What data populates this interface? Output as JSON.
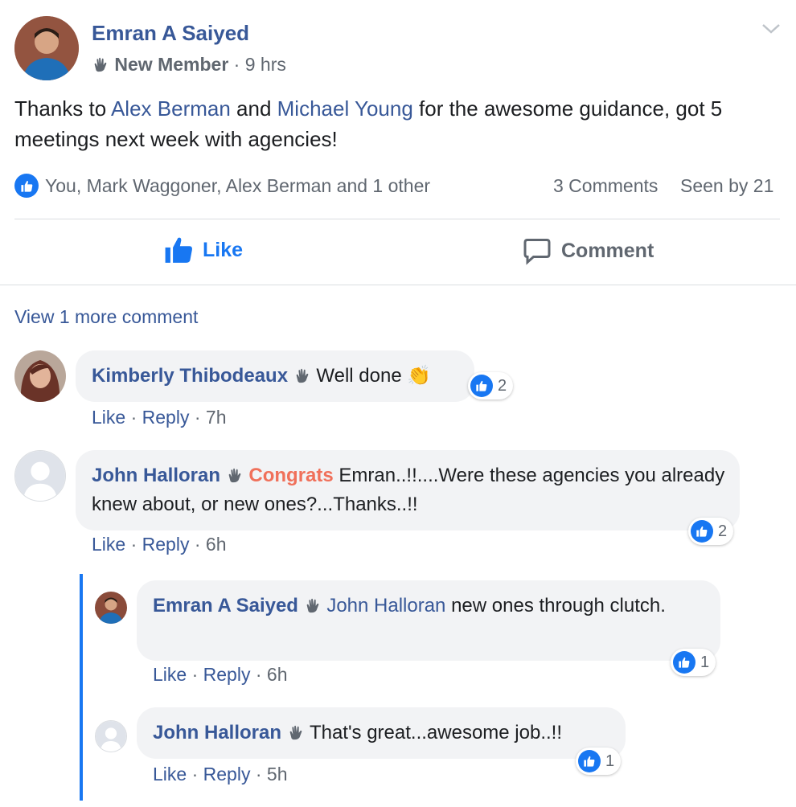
{
  "post": {
    "author": "Emran A Saiyed",
    "badge": "New Member",
    "time": "9 hrs",
    "separator": " · ",
    "text_1": "Thanks to ",
    "mention_1": "Alex Berman",
    "text_2": " and ",
    "mention_2": "Michael Young",
    "text_3": " for the awesome guidance, got 5 meetings next week with agencies!",
    "likes_summary": "You, Mark Waggoner, Alex Berman and 1 other",
    "comments_count": "3 Comments",
    "seen_by": "Seen by 21"
  },
  "actions": {
    "like": "Like",
    "comment": "Comment"
  },
  "view_more": "View 1 more comment",
  "comments": [
    {
      "author": "Kimberly Thibodeaux",
      "text": " Well done ",
      "emoji": "👏",
      "likes": "2",
      "like": "Like",
      "reply": "Reply",
      "time": "7h"
    },
    {
      "author": "John Halloran",
      "highlight": "Congrats",
      "text": " Emran..!!....Were these agencies you already knew about, or new ones?...Thanks..!!",
      "likes": "2",
      "like": "Like",
      "reply": "Reply",
      "time": "6h"
    }
  ],
  "replies": [
    {
      "author": "Emran A Saiyed",
      "mention": "John Halloran",
      "text": " new ones through clutch.",
      "likes": "1",
      "like": "Like",
      "reply": "Reply",
      "time": "6h"
    },
    {
      "author": "John Halloran",
      "text": " That's great...awesome job..!!",
      "likes": "1",
      "like": "Like",
      "reply": "Reply",
      "time": "5h"
    }
  ],
  "colors": {
    "link": "#385898",
    "accent": "#1877f2",
    "highlight": "#f0705a",
    "bubble": "#f2f3f5"
  }
}
